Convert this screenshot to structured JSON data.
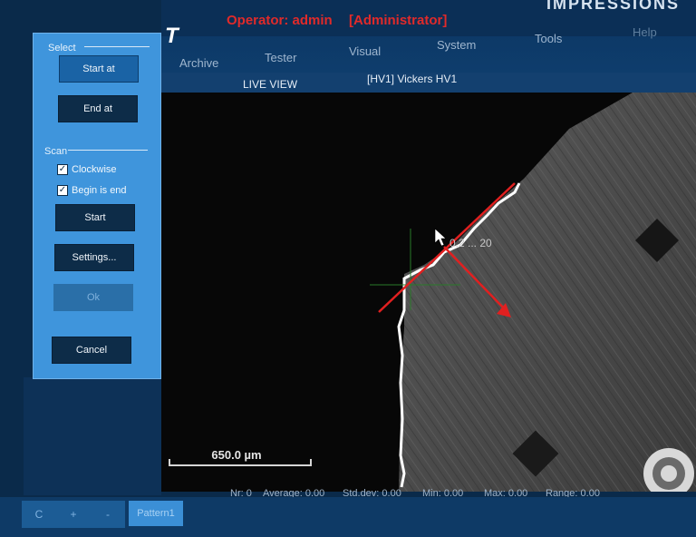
{
  "header": {
    "operator": "Operator: admin",
    "role": "[Administrator]",
    "brand": "IMPRESSIONS",
    "logo": "T"
  },
  "menu": {
    "items": [
      "Archive",
      "Tester",
      "Visual",
      "System",
      "Tools",
      "Help"
    ]
  },
  "live": {
    "mode": "LIVE VIEW",
    "method": "[HV1] Vickers HV1"
  },
  "panel": {
    "select_label": "Select",
    "start_at": "Start at",
    "end_at": "End at",
    "scan_label": "Scan",
    "clockwise": "Clockwise",
    "clockwise_checked": true,
    "begin_is_end": "Begin is end",
    "begin_is_end_checked": true,
    "start": "Start",
    "settings": "Settings...",
    "ok": "Ok",
    "cancel": "Cancel"
  },
  "view": {
    "scale": "650.0 µm",
    "overlay_text": "0.2 ... 20"
  },
  "stats": {
    "nr": "Nr: 0",
    "average": "Average: 0.00",
    "stddev": "Std.dev: 0.00",
    "min": "Min: 0.00",
    "max": "Max: 0.00",
    "range": "Range: 0.00"
  },
  "bottombar": {
    "c": "C",
    "plus": "+",
    "minus": "-",
    "pattern": "Pattern1"
  },
  "colors": {
    "panel": "#3f95dc",
    "dark_button": "#0d2c48",
    "accent_red": "#e02a2a",
    "frame": "#0a2a4a"
  }
}
